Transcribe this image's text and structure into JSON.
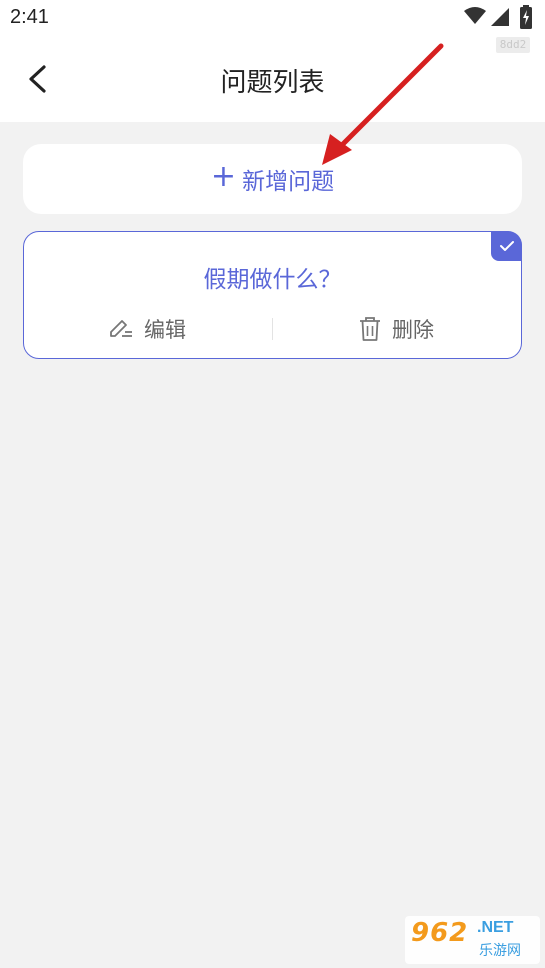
{
  "status_bar": {
    "time": "2:41",
    "tag": "8dd2",
    "icons": [
      "wifi-icon",
      "signal-icon",
      "battery-charging-icon"
    ]
  },
  "header": {
    "title": "问题列表",
    "back_icon": "chevron-left-icon"
  },
  "add_button": {
    "icon": "+",
    "label": "新增问题"
  },
  "questions": [
    {
      "title": "假期做什么？",
      "selected": true,
      "edit_label": "编辑",
      "delete_label": "删除"
    }
  ],
  "colors": {
    "accent": "#5a67d8",
    "background": "#f2f2f2",
    "annotation_arrow": "#d62020"
  },
  "watermark": {
    "brand_number": "962",
    "brand_suffix": ".NET",
    "brand_cn": "乐游网"
  }
}
